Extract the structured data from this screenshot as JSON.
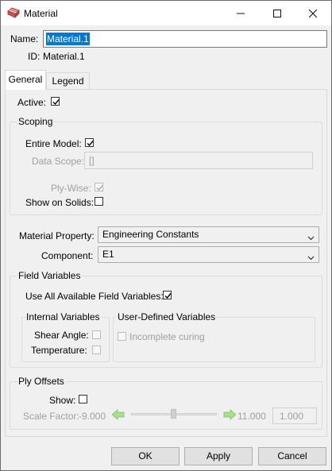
{
  "window": {
    "title": "Material",
    "icon": "material-icon"
  },
  "header": {
    "name_label": "Name:",
    "name_value": "Material.1",
    "id_label": "ID:",
    "id_value": "Material.1"
  },
  "tabs": [
    {
      "label": "General",
      "active": true
    },
    {
      "label": "Legend",
      "active": false
    }
  ],
  "general": {
    "active_label": "Active:",
    "active_checked": true,
    "scoping": {
      "title": "Scoping",
      "entire_model_label": "Entire Model:",
      "entire_model_checked": true,
      "data_scope_label": "Data Scope:",
      "data_scope_value": "[]",
      "ply_wise_label": "Ply-Wise:",
      "ply_wise_checked": true,
      "show_on_solids_label": "Show on Solids:",
      "show_on_solids_checked": false
    },
    "material_property_label": "Material Property:",
    "material_property_value": "Engineering Constants",
    "component_label": "Component:",
    "component_value": "E1",
    "field_variables": {
      "title": "Field Variables",
      "use_all_label": "Use All Available Field Variables:",
      "use_all_checked": true,
      "internal": {
        "title": "Internal Variables",
        "shear_angle_label": "Shear Angle:",
        "temperature_label": "Temperature:"
      },
      "user_defined": {
        "title": "User-Defined Variables",
        "incomplete_curing_label": "Incomplete curing"
      }
    },
    "ply_offsets": {
      "title": "Ply Offsets",
      "show_label": "Show:",
      "show_checked": false,
      "scale_factor_label": "Scale Factor:",
      "min_value": "-9.000",
      "max_value": "11.000",
      "current_value": "1.000",
      "slider_fraction": 0.5
    }
  },
  "buttons": {
    "ok": "OK",
    "apply": "Apply",
    "cancel": "Cancel"
  },
  "colors": {
    "selection": "#0078d7",
    "accent_arrow": "#a8e08a",
    "tab_active_bg": "#ffffff"
  }
}
